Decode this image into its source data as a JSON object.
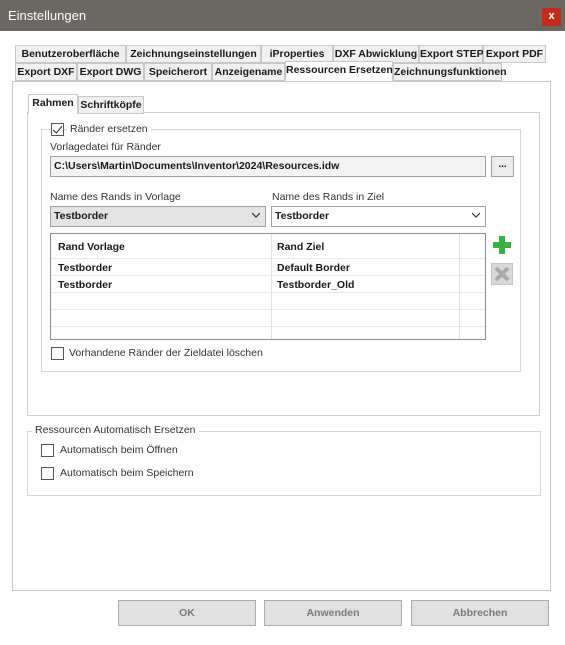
{
  "window": {
    "title": "Einstellungen",
    "close_label": "x"
  },
  "tabs_row1": [
    "Benutzeroberfläche",
    "Zeichnungseinstellungen",
    "iProperties",
    "DXF Abwicklung",
    "Export STEP",
    "Export PDF"
  ],
  "tabs_row2": [
    "Export DXF",
    "Export DWG",
    "Speicherort",
    "Anzeigename",
    "Ressourcen Ersetzen",
    "Zeichnungsfunktionen"
  ],
  "active_tab": "Ressourcen Ersetzen",
  "subtabs": [
    "Rahmen",
    "Schriftköpfe"
  ],
  "active_subtab": "Rahmen",
  "rahmen": {
    "replace_checkbox_label": "Ränder ersetzen",
    "replace_checked": true,
    "template_file_label": "Vorlagedatei für Ränder",
    "template_file_value": "C:\\Users\\Martin\\Documents\\Inventor\\2024\\Resources.idw",
    "browse_label": "...",
    "source_name_label": "Name des Rands in Vorlage",
    "source_name_value": "Testborder",
    "target_name_label": "Name des Rands in Ziel",
    "target_name_value": "Testborder",
    "table": {
      "headers": [
        "Rand Vorlage",
        "Rand Ziel"
      ],
      "rows": [
        [
          "Testborder",
          "Default Border"
        ],
        [
          "Testborder",
          "Testborder_Old"
        ]
      ]
    },
    "add_icon": "plus-icon",
    "remove_icon": "x-icon",
    "delete_existing_label": "Vorhandene Ränder der Zieldatei löschen",
    "delete_existing_checked": false
  },
  "auto_replace": {
    "group_title": "Ressourcen Automatisch Ersetzen",
    "on_open_label": "Automatisch beim Öffnen",
    "on_open_checked": false,
    "on_save_label": "Automatisch beim Speichern",
    "on_save_checked": false
  },
  "buttons": {
    "ok": "OK",
    "apply": "Anwenden",
    "cancel": "Abbrechen"
  },
  "colors": {
    "titlebar": "#6b6864",
    "close": "#c42b1c",
    "add_icon": "#3cb043",
    "remove_icon": "#a9a9a9"
  }
}
